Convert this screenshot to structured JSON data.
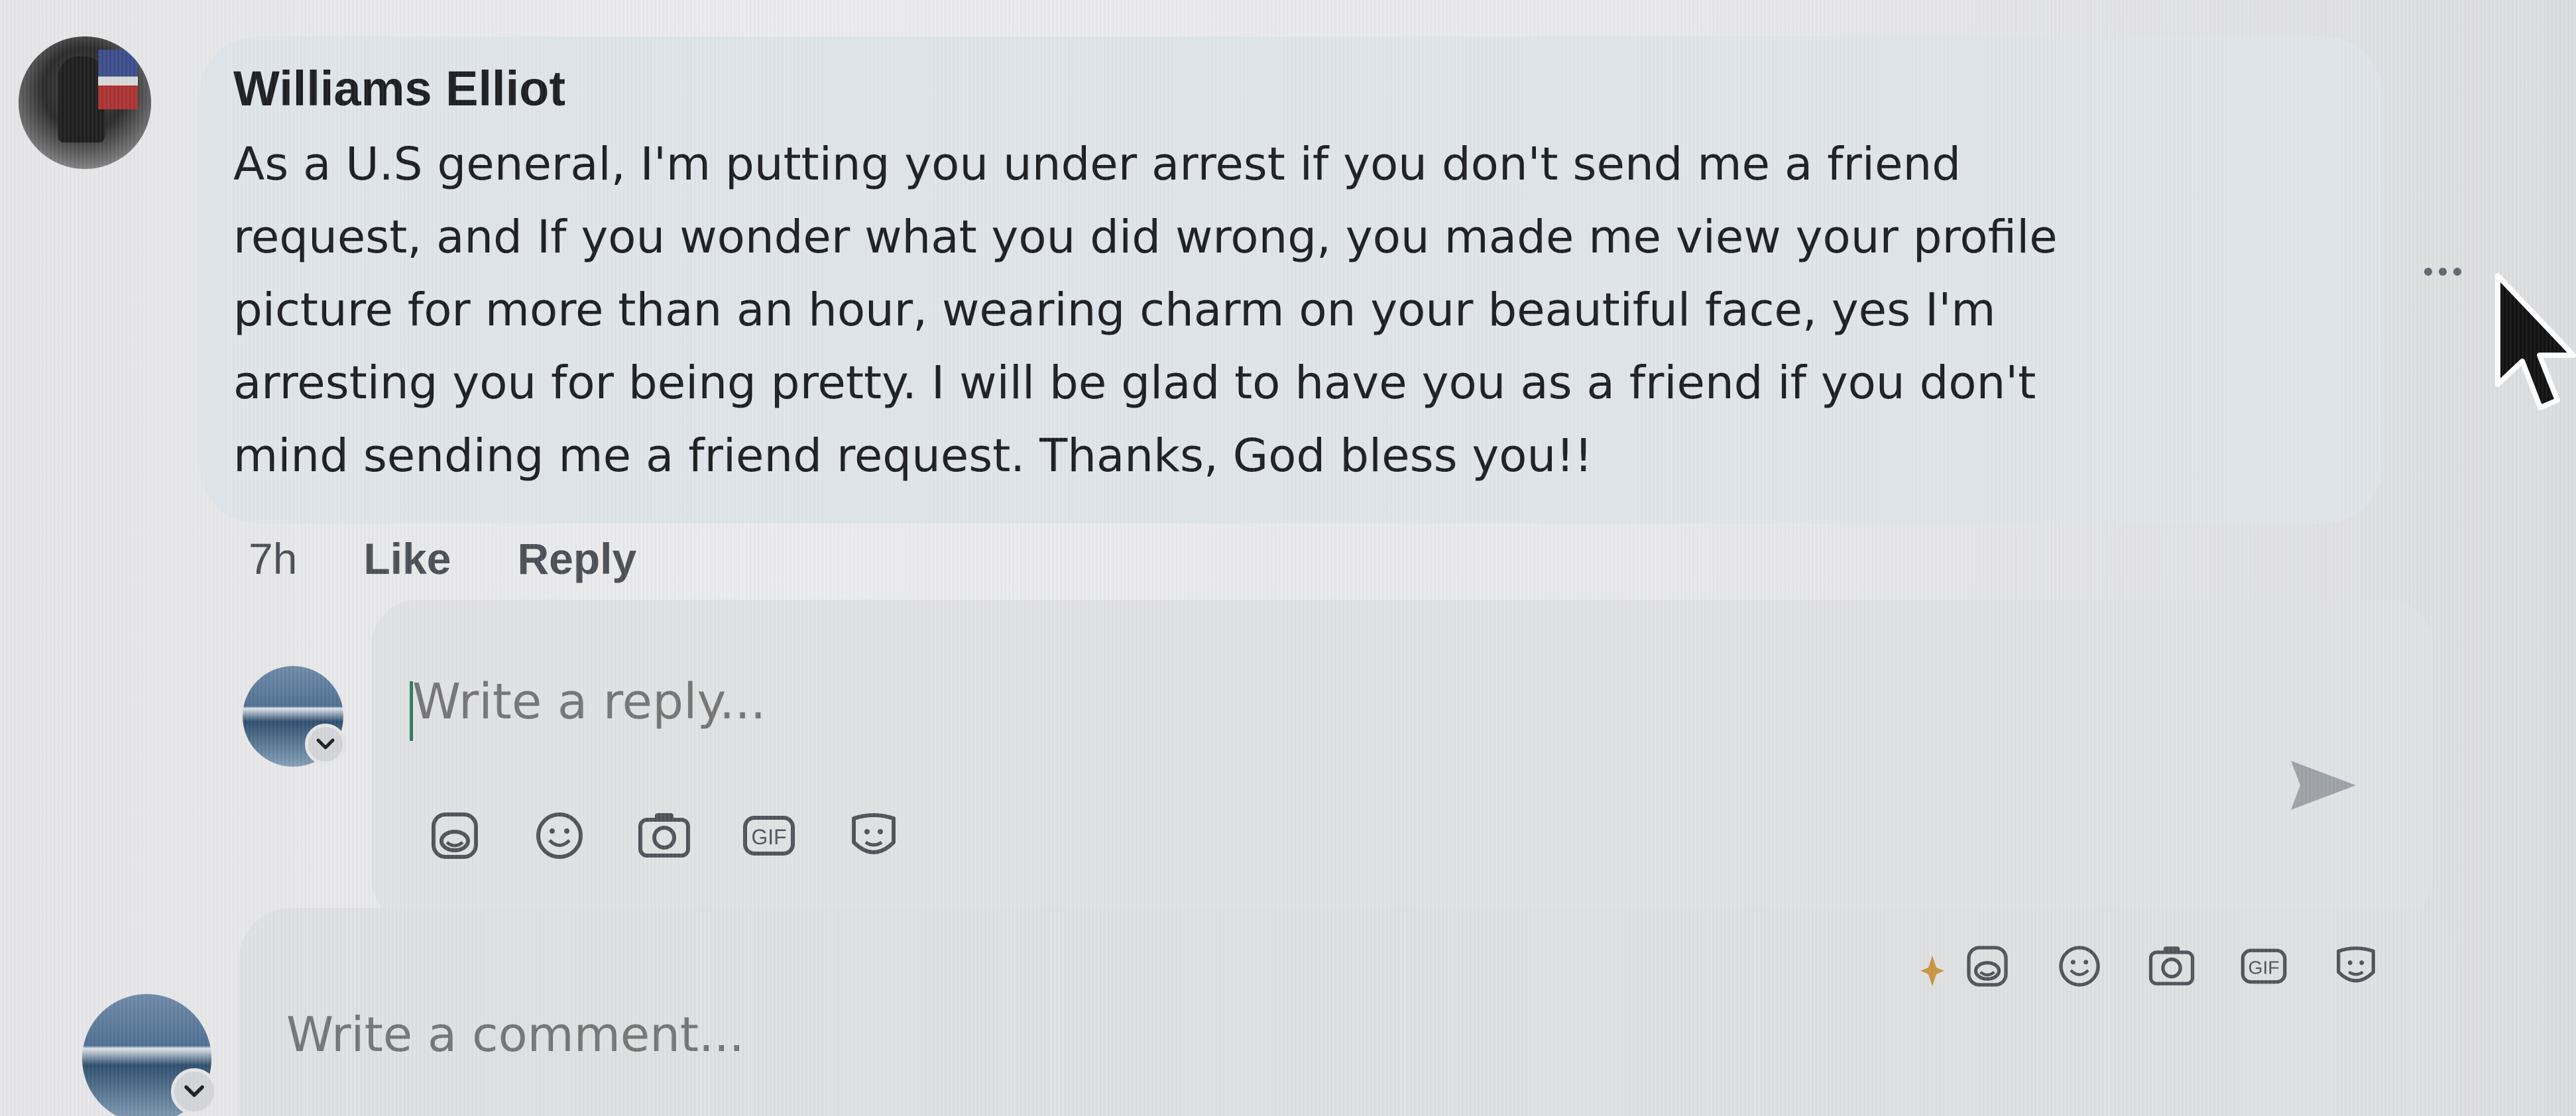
{
  "comment": {
    "author_name": "Williams Elliot",
    "text": "As a U.S general, I'm putting you under arrest if you don't send me a friend\nrequest, and If you wonder what you did wrong, you made me view your profile\npicture for more than an hour, wearing charm on your beautiful face, yes I'm\narresting you for being pretty. I will be glad to have you as a friend if you don't\nmind sending me a friend request. Thanks, God bless you!!",
    "timestamp": "7h",
    "like_label": "Like",
    "reply_label": "Reply"
  },
  "reply_box": {
    "placeholder": "Write a reply...",
    "tools": [
      "sticker-icon",
      "emoji-icon",
      "camera-icon",
      "gif-icon",
      "avatar-sticker-icon"
    ],
    "gif_label": "GIF"
  },
  "comment_box": {
    "placeholder": "Write a comment...",
    "tools": [
      "sticker-icon",
      "emoji-icon",
      "camera-icon",
      "gif-icon",
      "avatar-sticker-icon"
    ],
    "gif_label": "GIF"
  },
  "colors": {
    "bubble": "#dfe5ea",
    "text": "#1c1e21",
    "secondary_text": "#4b4f56",
    "caret": "#2d7d5a"
  }
}
